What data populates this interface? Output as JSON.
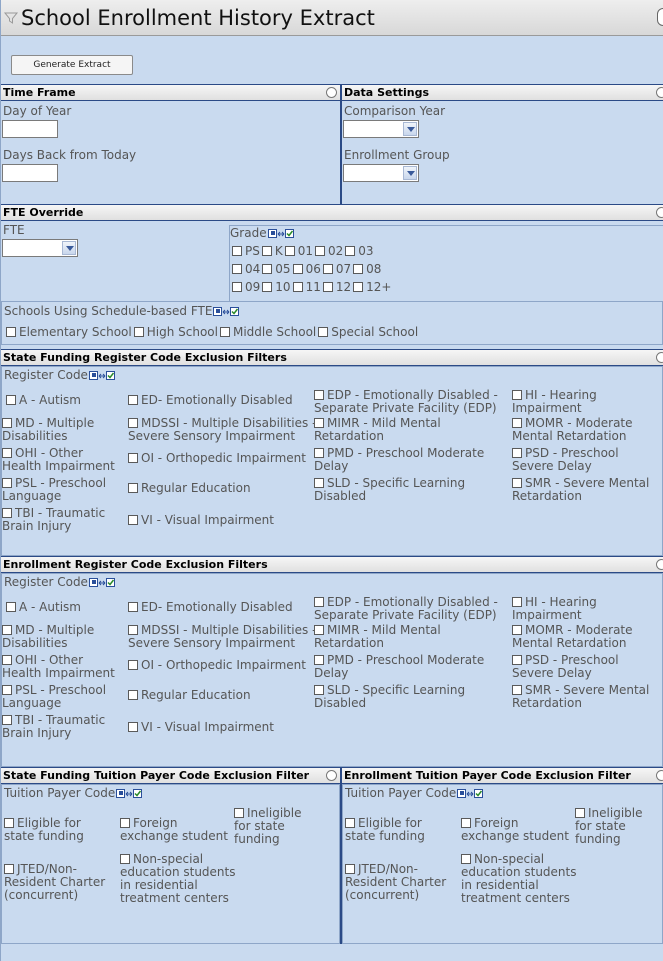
{
  "title": "School Enrollment History Extract",
  "generate_button": "Generate Extract",
  "time_frame": {
    "heading": "Time Frame",
    "day_of_year_label": "Day of Year",
    "day_of_year_value": "",
    "days_back_label": "Days Back from Today",
    "days_back_value": ""
  },
  "data_settings": {
    "heading": "Data Settings",
    "comparison_year_label": "Comparison Year",
    "comparison_year_value": "",
    "enrollment_group_label": "Enrollment Group",
    "enrollment_group_value": ""
  },
  "fte_override": {
    "heading": "FTE Override",
    "fte_label": "FTE",
    "fte_value": "",
    "grade_label": "Grade",
    "grade_rows": [
      [
        "PS",
        "K",
        "01",
        "02",
        "03"
      ],
      [
        "04",
        "05",
        "06",
        "07",
        "08"
      ],
      [
        "09",
        "10",
        "11",
        "12",
        "12+"
      ]
    ],
    "schedule_label": "Schools Using Schedule-based FTE",
    "schedule_options": [
      "Elementary School",
      "High School",
      "Middle School",
      "Special School"
    ]
  },
  "state_funding_register": {
    "heading": "State Funding Register Code Exclusion Filters",
    "register_label": "Register Code"
  },
  "enrollment_register": {
    "heading": "Enrollment Register Code Exclusion Filters",
    "register_label": "Register Code"
  },
  "register_codes": [
    "A - Autism",
    "ED- Emotionally Disabled",
    "EDP - Emotionally Disabled - Separate Private Facility (EDP)",
    "HI - Hearing Impairment",
    "MD - Multiple Disabilities",
    "MDSSI - Multiple Disabilities - Severe Sensory Impairment",
    "MIMR - Mild Mental Retardation",
    "MOMR - Moderate Mental Retardation",
    "OHI - Other Health Impairment",
    "OI - Orthopedic Impairment",
    "PMD - Preschool Moderate Delay",
    "PSD - Preschool Severe Delay",
    "PSL - Preschool Language",
    "Regular Education",
    "SLD - Specific Learning Disabled",
    "SMR - Severe Mental Retardation",
    "TBI - Traumatic Brain Injury",
    "VI - Visual Impairment"
  ],
  "state_tuition": {
    "heading": "State Funding Tuition Payer Code Exclusion Filter",
    "payer_label": "Tuition Payer Code"
  },
  "enrollment_tuition": {
    "heading": "Enrollment Tuition Payer Code Exclusion Filter",
    "payer_label": "Tuition Payer Code"
  },
  "tuition_codes": [
    "Eligible for state funding",
    "Foreign exchange student",
    "Ineligible for state funding",
    "JTED/Non-Resident Charter (concurrent)",
    "Non-special education students in residential treatment centers"
  ],
  "colors": {
    "background": "#c9daef",
    "section_border": "#2b4a86"
  }
}
